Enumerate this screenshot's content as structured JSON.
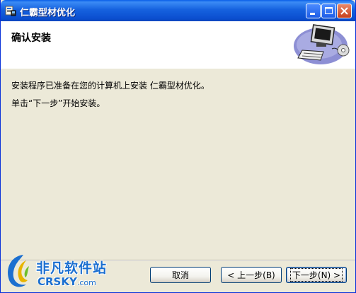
{
  "window": {
    "title": "仁霸型材优化",
    "icon": "installer-icon"
  },
  "header": {
    "title": "确认安装",
    "graphic": "computer-install-graphic"
  },
  "body": {
    "line1": "安装程序已准备在您的计算机上安装 仁霸型材优化。",
    "line2": "单击“下一步”开始安装。"
  },
  "buttons": {
    "cancel": "取消",
    "back": "< 上一步(B)",
    "next": "下一步(N) >"
  },
  "watermark": {
    "cn": "非凡软件站",
    "en": "CRSKY",
    "domain": ".com"
  },
  "colors": {
    "titlebar": "#1662df",
    "face": "#ece9d8",
    "watermark_blue": "#1b6fd0"
  }
}
